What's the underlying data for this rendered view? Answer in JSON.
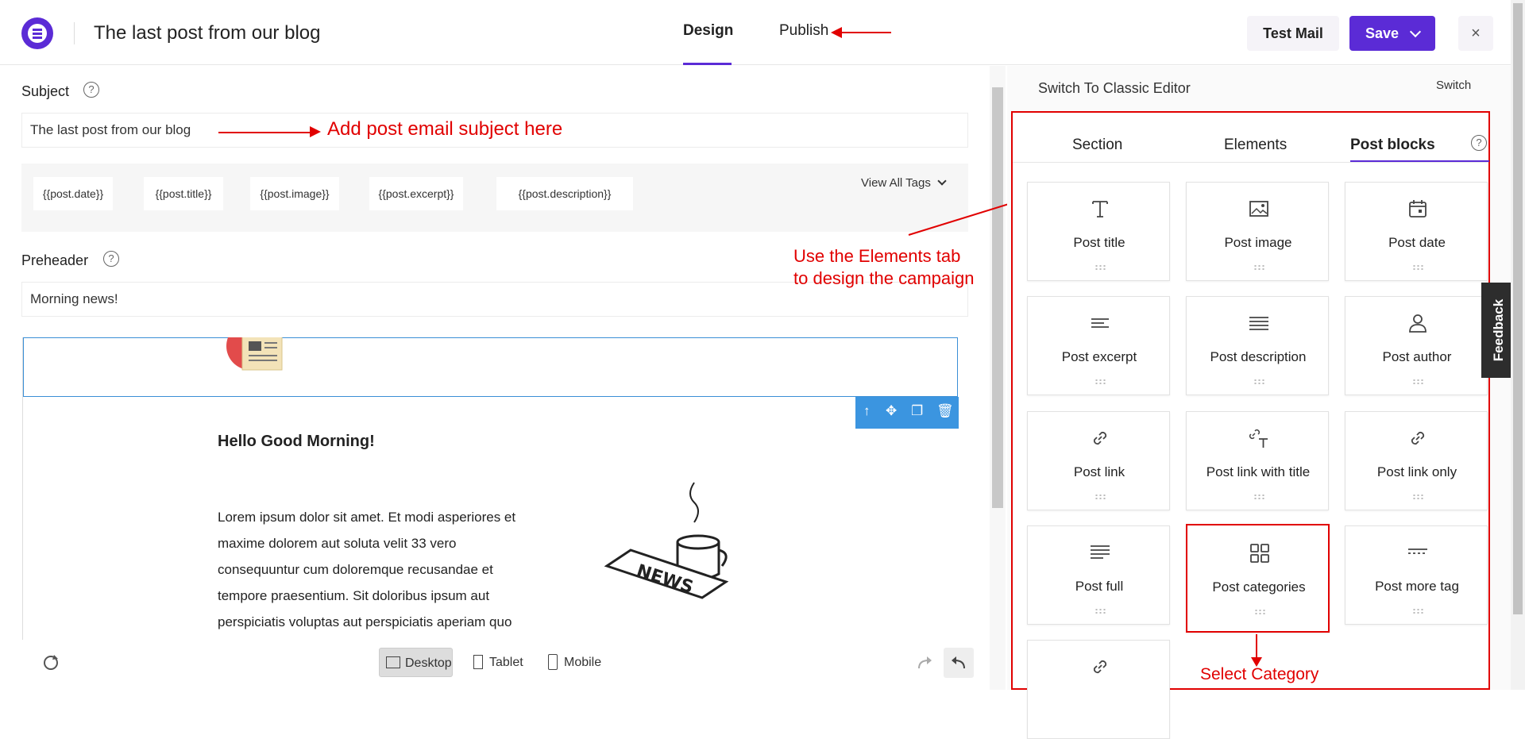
{
  "header": {
    "title": "The last post from our blog",
    "tabs": [
      {
        "label": "Design"
      },
      {
        "label": "Publish"
      }
    ],
    "test_mail": "Test Mail",
    "save": "Save",
    "close": "×"
  },
  "subject": {
    "label": "Subject",
    "value": "The last post from our blog",
    "tags": [
      "{{post.date}}",
      "{{post.title}}",
      "{{post.image}}",
      "{{post.excerpt}}",
      "{{post.description}}"
    ],
    "view_all": "View All Tags"
  },
  "preheader": {
    "label": "Preheader",
    "value": "Morning news!"
  },
  "help": "?",
  "email": {
    "heading": "Hello Good Morning!",
    "body": "Lorem ipsum dolor sit amet. Et modi asperiores et maxime dolorem aut soluta velit 33 vero consequuntur cum doloremque recusandae et tempore praesentium. Sit doloribus ipsum aut perspiciatis voluptas aut perspiciatis aperiam quo"
  },
  "devices": [
    "Desktop",
    "Tablet",
    "Mobile"
  ],
  "sidebar": {
    "switch_label": "Switch To Classic Editor",
    "switch_button": "Switch",
    "tabs": [
      "Section",
      "Elements",
      "Post blocks"
    ],
    "blocks": [
      {
        "label": "Post title",
        "icon": "text-t-icon"
      },
      {
        "label": "Post image",
        "icon": "image-icon"
      },
      {
        "label": "Post date",
        "icon": "calendar-icon"
      },
      {
        "label": "Post excerpt",
        "icon": "short-lines-icon"
      },
      {
        "label": "Post description",
        "icon": "lines-icon"
      },
      {
        "label": "Post author",
        "icon": "person-icon"
      },
      {
        "label": "Post link",
        "icon": "link-icon"
      },
      {
        "label": "Post link with title",
        "icon": "link-title-icon"
      },
      {
        "label": "Post link only",
        "icon": "link-icon"
      },
      {
        "label": "Post full",
        "icon": "full-lines-icon"
      },
      {
        "label": "Post categories",
        "icon": "grid-icon"
      },
      {
        "label": "Post more tag",
        "icon": "more-tag-icon"
      },
      {
        "label": "",
        "icon": "link-icon"
      }
    ]
  },
  "feedback": "Feedback",
  "annotations": {
    "subject": "Add post email subject here",
    "elements_line1": "Use the Elements tab",
    "elements_line2": "to design the campaign",
    "category": "Select Category"
  },
  "colors": {
    "accent": "#5b2bd6",
    "annotation": "#e10000",
    "toolbar": "#3b95e0"
  }
}
